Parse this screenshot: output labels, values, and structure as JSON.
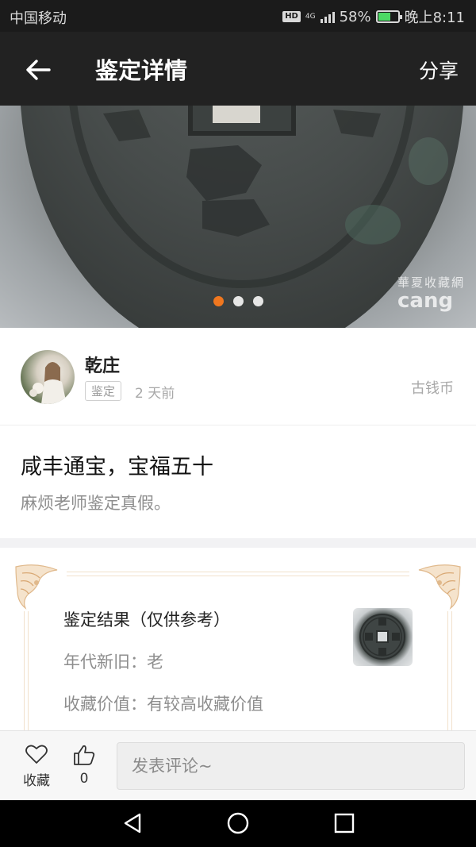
{
  "status_bar": {
    "carrier": "中国移动",
    "hd": "HD",
    "network": "4G",
    "battery": "58%",
    "battery_level": 0.58,
    "time": "晚上8:11"
  },
  "app_bar": {
    "back_icon": "arrow-left-icon",
    "title": "鉴定详情",
    "share_label": "分享"
  },
  "hero": {
    "watermark_cn": "華夏收藏網",
    "watermark_en": "cang",
    "slide_count": 3,
    "active_slide": 1
  },
  "user": {
    "name": "乾庄",
    "tag": "鉴定",
    "time": "2 天前",
    "category": "古钱币"
  },
  "post": {
    "title": "咸丰通宝，宝福五十",
    "description": "麻烦老师鉴定真假。"
  },
  "result": {
    "title": "鉴定结果（仅供参考）",
    "age_label": "年代新旧：老",
    "value_label": "收藏价值：有较高收藏价值"
  },
  "bottom_bar": {
    "favorite_label": "收藏",
    "like_count": "0",
    "comment_placeholder": "发表评论~"
  },
  "colors": {
    "accent": "#f0771f",
    "app_bar_bg": "#222222",
    "ornament": "#e8c9a4"
  }
}
